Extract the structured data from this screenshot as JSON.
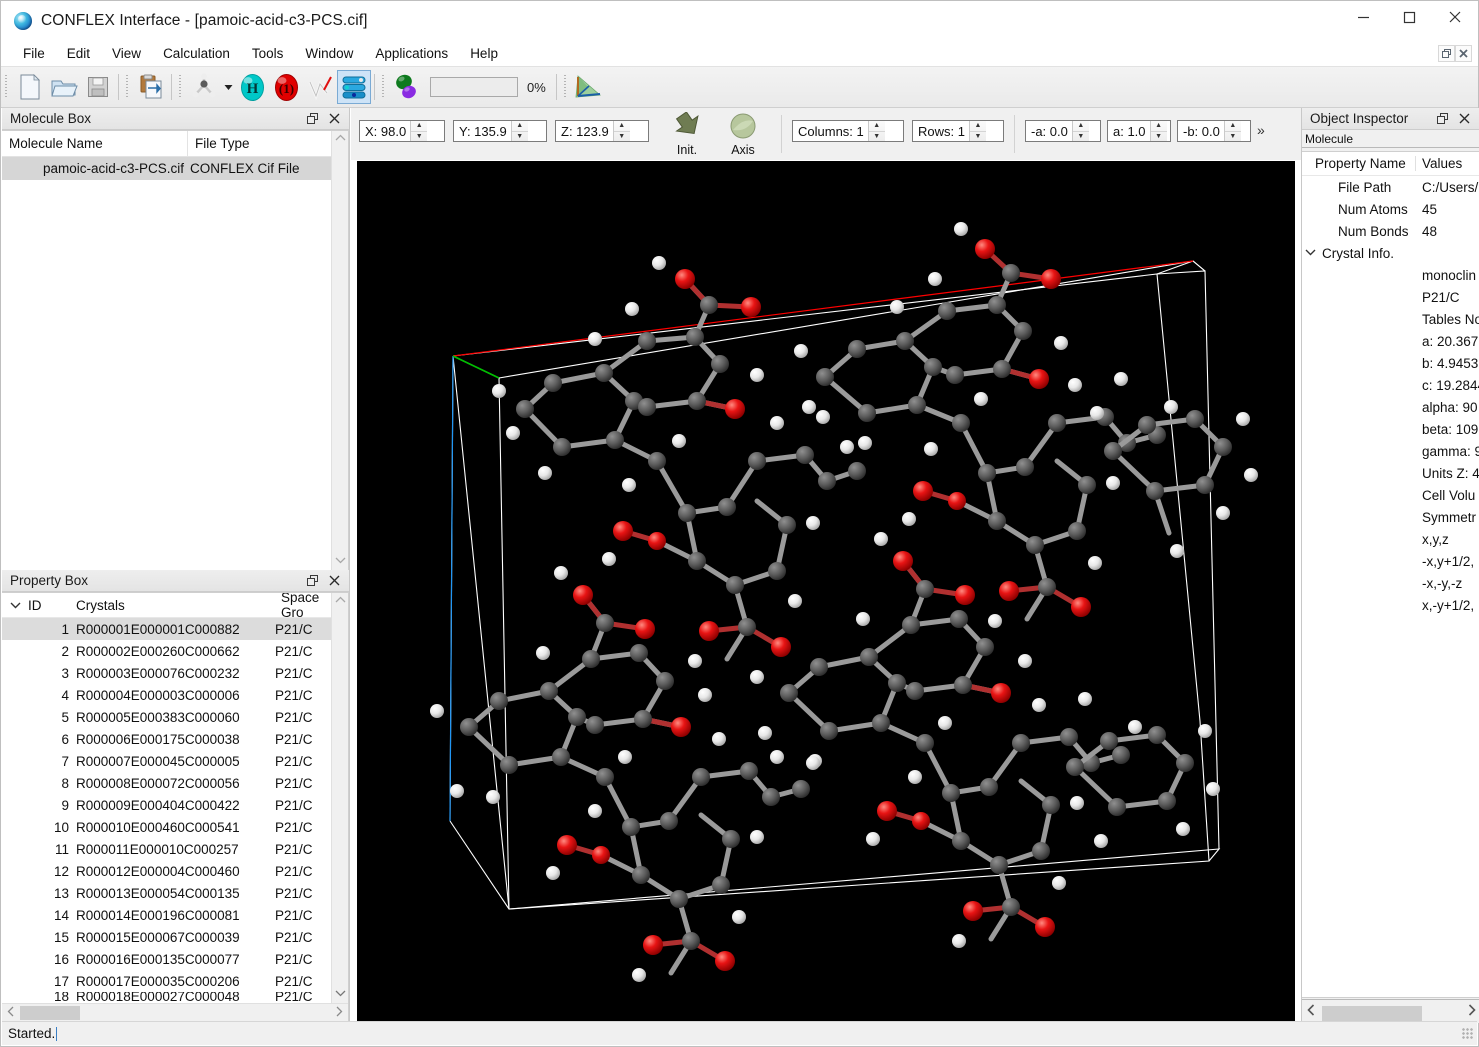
{
  "window": {
    "title": "CONFLEX Interface - [pamoic-acid-c3-PCS.cif]",
    "logo_icon": "conflex-logo-icon",
    "minimize_label": "Minimize",
    "maximize_label": "Maximize",
    "close_label": "Close"
  },
  "menubar": {
    "items": [
      {
        "label": "File"
      },
      {
        "label": "Edit"
      },
      {
        "label": "View"
      },
      {
        "label": "Calculation"
      },
      {
        "label": "Tools"
      },
      {
        "label": "Window"
      },
      {
        "label": "Applications"
      },
      {
        "label": "Help"
      }
    ],
    "mdi_restore_icon": "restore-window-icon",
    "mdi_close_icon": "close-window-icon"
  },
  "toolbar": {
    "groups": [
      {
        "buttons": [
          {
            "icon": "new-document-icon",
            "label": "New"
          },
          {
            "icon": "open-folder-icon",
            "label": "Open"
          },
          {
            "icon": "save-floppy-icon",
            "label": "Save"
          }
        ]
      },
      {
        "buttons": [
          {
            "icon": "import-clipboard-icon",
            "label": "Import"
          }
        ]
      },
      {
        "buttons": [
          {
            "icon": "molecule-model-icon",
            "label": "Model"
          },
          {
            "icon": "dropdown-arrow-icon",
            "label": "Model options"
          },
          {
            "icon": "hydrogen-atom-icon",
            "label": "Add hydrogen"
          },
          {
            "icon": "charge-atom-icon",
            "label": "Formal charge"
          },
          {
            "icon": "measure-pen-icon",
            "label": "Measure"
          },
          {
            "icon": "stacked-layers-icon",
            "label": "Crystal layers"
          }
        ]
      },
      {
        "buttons": [
          {
            "icon": "two-spheres-icon",
            "label": "Conformation search"
          }
        ],
        "progress": {
          "value": 0,
          "text": "0%"
        }
      },
      {
        "buttons": [
          {
            "icon": "axis-tripod-icon",
            "label": "Axis tripod"
          }
        ]
      }
    ]
  },
  "molecule_box": {
    "title": "Molecule Box",
    "float_icon": "float-panel-icon",
    "close_icon": "close-icon",
    "columns": [
      "Molecule Name",
      "File Type"
    ],
    "rows": [
      {
        "name": "pamoic-acid-c3-PCS.cif",
        "file_type": "CONFLEX Cif File",
        "selected": true
      }
    ],
    "scroll_up_icon": "chevron-up-icon",
    "scroll_down_icon": "chevron-down-icon"
  },
  "property_box": {
    "title": "Property Box",
    "float_icon": "float-panel-icon",
    "close_icon": "close-icon",
    "tree_toggle_icon": "chevron-down-icon",
    "columns": [
      "ID",
      "Crystals",
      "Space Gro"
    ],
    "scroll_up_icon": "chevron-up-icon",
    "scroll_down_icon": "chevron-down-icon",
    "hscroll_left_icon": "chevron-left-icon",
    "hscroll_right_icon": "chevron-right-icon",
    "rows": [
      {
        "id": "1",
        "crystal": "R000001E000001C000882",
        "space_group": "P21/C",
        "selected": true
      },
      {
        "id": "2",
        "crystal": "R000002E000260C000662",
        "space_group": "P21/C"
      },
      {
        "id": "3",
        "crystal": "R000003E000076C000232",
        "space_group": "P21/C"
      },
      {
        "id": "4",
        "crystal": "R000004E000003C000006",
        "space_group": "P21/C"
      },
      {
        "id": "5",
        "crystal": "R000005E000383C000060",
        "space_group": "P21/C"
      },
      {
        "id": "6",
        "crystal": "R000006E000175C000038",
        "space_group": "P21/C"
      },
      {
        "id": "7",
        "crystal": "R000007E000045C000005",
        "space_group": "P21/C"
      },
      {
        "id": "8",
        "crystal": "R000008E000072C000056",
        "space_group": "P21/C"
      },
      {
        "id": "9",
        "crystal": "R000009E000404C000422",
        "space_group": "P21/C"
      },
      {
        "id": "10",
        "crystal": "R000010E000460C000541",
        "space_group": "P21/C"
      },
      {
        "id": "11",
        "crystal": "R000011E000010C000257",
        "space_group": "P21/C"
      },
      {
        "id": "12",
        "crystal": "R000012E000004C000460",
        "space_group": "P21/C"
      },
      {
        "id": "13",
        "crystal": "R000013E000054C000135",
        "space_group": "P21/C"
      },
      {
        "id": "14",
        "crystal": "R000014E000196C000081",
        "space_group": "P21/C"
      },
      {
        "id": "15",
        "crystal": "R000015E000067C000039",
        "space_group": "P21/C"
      },
      {
        "id": "16",
        "crystal": "R000016E000135C000077",
        "space_group": "P21/C"
      },
      {
        "id": "17",
        "crystal": "R000017E000035C000206",
        "space_group": "P21/C"
      },
      {
        "id": "18",
        "crystal": "R000018E000027C000048",
        "space_group": "P21/C",
        "partial": true
      }
    ]
  },
  "viewbar": {
    "spinners": [
      {
        "name": "rotation-x",
        "value": "X: 98.0"
      },
      {
        "name": "rotation-y",
        "value": "Y: 135.9"
      },
      {
        "name": "rotation-z",
        "value": "Z: 123.9"
      }
    ],
    "buttons": [
      {
        "name": "init-button",
        "label": "Init.",
        "icon": "reset-arrow-icon"
      },
      {
        "name": "axis-button",
        "label": "Axis",
        "icon": "sphere-icon"
      }
    ],
    "grid_spinners": [
      {
        "name": "columns-spinner",
        "value": "Columns: 1"
      },
      {
        "name": "rows-spinner",
        "value": "Rows: 1"
      }
    ],
    "axis_spinners": [
      {
        "name": "minus-a-spinner",
        "value": "-a: 0.0"
      },
      {
        "name": "a-spinner",
        "value": "a: 1.0"
      },
      {
        "name": "minus-b-spinner",
        "value": "-b: 0.0"
      }
    ],
    "overflow_icon": "double-chevron-right-icon",
    "overflow_label": "»",
    "spinner_up_icon": "spin-up-icon",
    "spinner_down_icon": "spin-down-icon"
  },
  "object_inspector": {
    "title": "Object Inspector",
    "float_icon": "float-panel-icon",
    "close_icon": "close-icon",
    "selector_value": "Molecule",
    "columns": [
      "Property Name",
      "Values"
    ],
    "rows": [
      {
        "label": "File Path",
        "value": "C:/Users/",
        "indent": true
      },
      {
        "label": "Num Atoms",
        "value": "45",
        "indent": true
      },
      {
        "label": "Num Bonds",
        "value": "48",
        "indent": true
      },
      {
        "label": "Crystal Info.",
        "value": "",
        "chevron": "⌄",
        "indent": false
      },
      {
        "label": "",
        "value": "monoclin"
      },
      {
        "label": "",
        "value": "P21/C"
      },
      {
        "label": "",
        "value": "Tables No"
      },
      {
        "label": "",
        "value": "a: 20.367"
      },
      {
        "label": "",
        "value": "b: 4.9453"
      },
      {
        "label": "",
        "value": "c: 19.2844"
      },
      {
        "label": "",
        "value": "alpha: 90"
      },
      {
        "label": "",
        "value": "beta: 109"
      },
      {
        "label": "",
        "value": "gamma: 9"
      },
      {
        "label": "",
        "value": "Units Z: 4"
      },
      {
        "label": "",
        "value": "Cell Volu"
      },
      {
        "label": "",
        "value": "Symmetr"
      },
      {
        "label": "",
        "value": "x,y,z"
      },
      {
        "label": "",
        "value": "-x,y+1/2,"
      },
      {
        "label": "",
        "value": "-x,-y,-z"
      },
      {
        "label": "",
        "value": "x,-y+1/2,"
      }
    ],
    "hscroll_left_icon": "chevron-left-icon",
    "hscroll_right_icon": "chevron-right-icon"
  },
  "viewport": {
    "background_color": "#000000",
    "cell_edge_color": "#ffffff",
    "axis_a_color": "#ff0000",
    "axis_b_color": "#00c000",
    "axis_c_color": "#2196f3",
    "atom_carbon_color": "#585858",
    "atom_oxygen_color": "#e01010",
    "atom_hydrogen_color": "#f2f2f2",
    "bond_color": "#9a9a9a",
    "description": "pamoic acid crystal unit cell, ball-and-stick, 4 molecules"
  },
  "statusbar": {
    "message": "Started.",
    "resize_grip_icon": "resize-grip-icon"
  }
}
